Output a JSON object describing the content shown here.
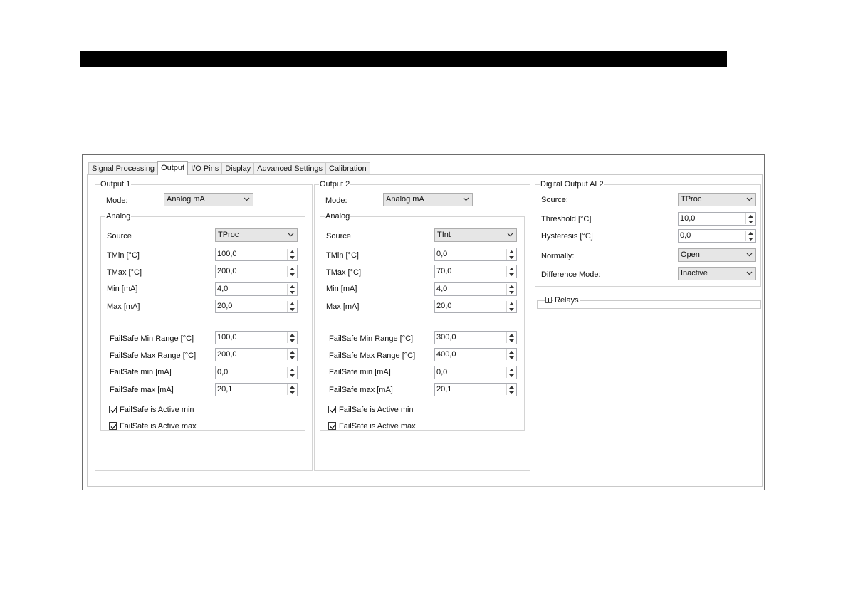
{
  "tabs": [
    "Signal Processing",
    "Output",
    "I/O Pins",
    "Display",
    "Advanced Settings",
    "Calibration"
  ],
  "output1": {
    "title": "Output 1",
    "mode_label": "Mode:",
    "mode_value": "Analog mA",
    "analog_title": "Analog",
    "source_label": "Source",
    "source_value": "TProc",
    "tmin_label": "TMin [°C]",
    "tmin_value": "100,0",
    "tmax_label": "TMax [°C]",
    "tmax_value": "200,0",
    "min_label": "Min [mA]",
    "min_value": "4,0",
    "max_label": "Max [mA]",
    "max_value": "20,0",
    "fs_min_range_label": "FailSafe Min Range [°C]",
    "fs_min_range_value": "100,0",
    "fs_max_range_label": "FailSafe Max Range [°C]",
    "fs_max_range_value": "200,0",
    "fs_min_label": "FailSafe min [mA]",
    "fs_min_value": "0,0",
    "fs_max_label": "FailSafe max [mA]",
    "fs_max_value": "20,1",
    "fs_active_min_label": "FailSafe is Active min",
    "fs_active_min_checked": true,
    "fs_active_max_label": "FailSafe is Active max",
    "fs_active_max_checked": true
  },
  "output2": {
    "title": "Output 2",
    "mode_label": "Mode:",
    "mode_value": "Analog mA",
    "analog_title": "Analog",
    "source_label": "Source",
    "source_value": "TInt",
    "tmin_label": "TMin [°C]",
    "tmin_value": "0,0",
    "tmax_label": "TMax [°C]",
    "tmax_value": "70,0",
    "min_label": "Min [mA]",
    "min_value": "4,0",
    "max_label": "Max [mA]",
    "max_value": "20,0",
    "fs_min_range_label": "FailSafe Min Range [°C]",
    "fs_min_range_value": "300,0",
    "fs_max_range_label": "FailSafe Max Range [°C]",
    "fs_max_range_value": "400,0",
    "fs_min_label": "FailSafe min [mA]",
    "fs_min_value": "0,0",
    "fs_max_label": "FailSafe max [mA]",
    "fs_max_value": "20,1",
    "fs_active_min_label": "FailSafe is Active min",
    "fs_active_min_checked": true,
    "fs_active_max_label": "FailSafe is Active max",
    "fs_active_max_checked": true
  },
  "digital": {
    "title": "Digital Output AL2",
    "source_label": "Source:",
    "source_value": "TProc",
    "threshold_label": "Threshold [°C]",
    "threshold_value": "10,0",
    "hysteresis_label": "Hysteresis [°C]",
    "hysteresis_value": "0,0",
    "normally_label": "Normally:",
    "normally_value": "Open",
    "diffmode_label": "Difference Mode:",
    "diffmode_value": "Inactive"
  },
  "relays": {
    "label": "Relays"
  }
}
